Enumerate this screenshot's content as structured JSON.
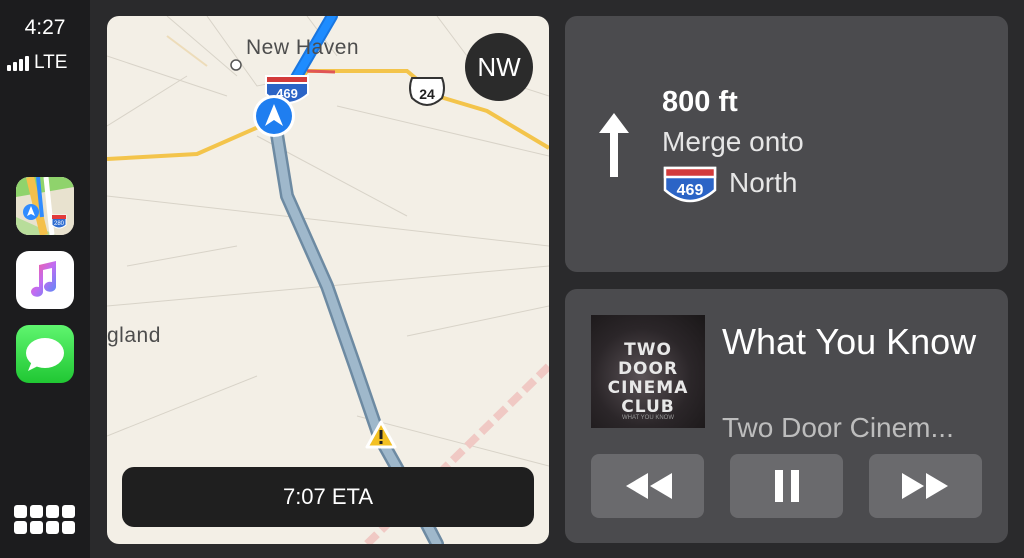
{
  "status": {
    "time": "4:27",
    "network": "LTE"
  },
  "dock": {
    "apps": [
      {
        "name": "Maps",
        "icon": "maps-icon"
      },
      {
        "name": "Music",
        "icon": "music-icon"
      },
      {
        "name": "Messages",
        "icon": "messages-icon"
      }
    ],
    "home_icon": "app-grid-icon",
    "maps_shield_text": "280"
  },
  "map": {
    "city_label": "New Haven",
    "region_label": "gland",
    "interstate_shield": "469",
    "us_route_shield": "24",
    "compass_heading": "NW",
    "eta_text": "7:07 ETA",
    "warning_icon": "warning-icon",
    "location_icon": "current-location-arrow-icon"
  },
  "navigation": {
    "distance": "800 ft",
    "instruction": "Merge onto",
    "shield": "469",
    "direction": "North",
    "maneuver_icon": "arrow-up-icon"
  },
  "now_playing": {
    "title": "What You Know",
    "artist": "Two Door Cinem...",
    "album_art_text": [
      "TWO",
      "DOOR",
      "CINEMA",
      "CLUB"
    ],
    "album_art_subtext": "WHAT YOU KNOW",
    "controls": [
      "rewind-icon",
      "pause-icon",
      "fast-forward-icon"
    ]
  },
  "colors": {
    "route_blue": "#1e8cff",
    "route_traveled": "#8aa6bd",
    "highway_yellow": "#f5c84a",
    "panel_gray": "#4b4b4e",
    "sidebar_black": "#1c1c1e"
  }
}
